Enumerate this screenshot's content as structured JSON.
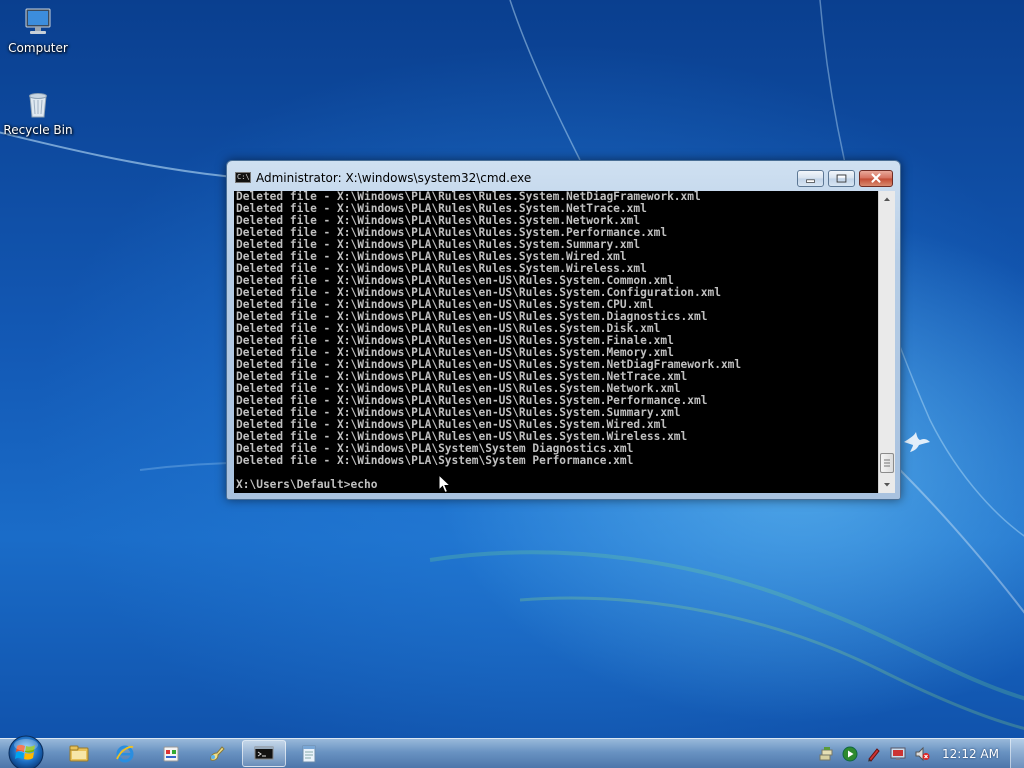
{
  "desktop": {
    "icons": [
      {
        "label": "Computer",
        "icon": "computer-icon"
      },
      {
        "label": "Recycle Bin",
        "icon": "recycle-bin-icon"
      }
    ]
  },
  "cmd_window": {
    "title": "Administrator: X:\\windows\\system32\\cmd.exe",
    "title_icon": "C:\\",
    "lines": [
      "Deleted file - X:\\Windows\\PLA\\Rules\\Rules.System.NetDiagFramework.xml",
      "Deleted file - X:\\Windows\\PLA\\Rules\\Rules.System.NetTrace.xml",
      "Deleted file - X:\\Windows\\PLA\\Rules\\Rules.System.Network.xml",
      "Deleted file - X:\\Windows\\PLA\\Rules\\Rules.System.Performance.xml",
      "Deleted file - X:\\Windows\\PLA\\Rules\\Rules.System.Summary.xml",
      "Deleted file - X:\\Windows\\PLA\\Rules\\Rules.System.Wired.xml",
      "Deleted file - X:\\Windows\\PLA\\Rules\\Rules.System.Wireless.xml",
      "Deleted file - X:\\Windows\\PLA\\Rules\\en-US\\Rules.System.Common.xml",
      "Deleted file - X:\\Windows\\PLA\\Rules\\en-US\\Rules.System.Configuration.xml",
      "Deleted file - X:\\Windows\\PLA\\Rules\\en-US\\Rules.System.CPU.xml",
      "Deleted file - X:\\Windows\\PLA\\Rules\\en-US\\Rules.System.Diagnostics.xml",
      "Deleted file - X:\\Windows\\PLA\\Rules\\en-US\\Rules.System.Disk.xml",
      "Deleted file - X:\\Windows\\PLA\\Rules\\en-US\\Rules.System.Finale.xml",
      "Deleted file - X:\\Windows\\PLA\\Rules\\en-US\\Rules.System.Memory.xml",
      "Deleted file - X:\\Windows\\PLA\\Rules\\en-US\\Rules.System.NetDiagFramework.xml",
      "Deleted file - X:\\Windows\\PLA\\Rules\\en-US\\Rules.System.NetTrace.xml",
      "Deleted file - X:\\Windows\\PLA\\Rules\\en-US\\Rules.System.Network.xml",
      "Deleted file - X:\\Windows\\PLA\\Rules\\en-US\\Rules.System.Performance.xml",
      "Deleted file - X:\\Windows\\PLA\\Rules\\en-US\\Rules.System.Summary.xml",
      "Deleted file - X:\\Windows\\PLA\\Rules\\en-US\\Rules.System.Wired.xml",
      "Deleted file - X:\\Windows\\PLA\\Rules\\en-US\\Rules.System.Wireless.xml",
      "Deleted file - X:\\Windows\\PLA\\System\\System Diagnostics.xml",
      "Deleted file - X:\\Windows\\PLA\\System\\System Performance.xml",
      "",
      "X:\\Users\\Default>echo"
    ],
    "colors": {
      "console_bg": "#000000",
      "console_fg": "#c0c0c0"
    }
  },
  "taskbar": {
    "pinned": [
      {
        "icon": "windows-explorer-icon",
        "active": false
      },
      {
        "icon": "internet-explorer-icon",
        "active": false
      },
      {
        "icon": "application-icon",
        "active": false
      },
      {
        "icon": "paint-brush-icon",
        "active": false
      },
      {
        "icon": "command-prompt-icon",
        "active": true
      },
      {
        "icon": "notepad-icon",
        "active": false
      }
    ],
    "tray_icons": [
      "network-icon",
      "media-play-icon",
      "pen-icon",
      "remote-display-icon",
      "volume-muted-icon"
    ],
    "clock": "12:12 AM"
  }
}
